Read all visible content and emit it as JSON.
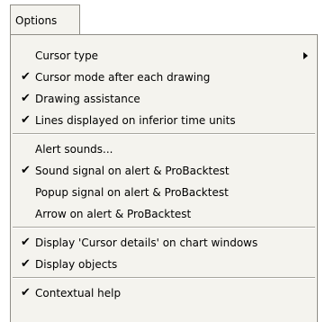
{
  "menubar": {
    "options_label": "Options"
  },
  "menu": {
    "items": [
      {
        "label": "Cursor type",
        "checked": false,
        "submenu": true
      },
      {
        "label": "Cursor mode after each drawing",
        "checked": true
      },
      {
        "label": "Drawing assistance",
        "checked": true
      },
      {
        "label": "Lines displayed on inferior time units",
        "checked": true
      },
      {
        "label": "Alert sounds...",
        "checked": false
      },
      {
        "label": "Sound signal on alert & ProBacktest",
        "checked": true
      },
      {
        "label": "Popup signal on alert & ProBacktest",
        "checked": false
      },
      {
        "label": "Arrow on alert & ProBacktest",
        "checked": false
      },
      {
        "label": "Display 'Cursor details' on chart windows",
        "checked": true
      },
      {
        "label": "Display objects",
        "checked": true
      },
      {
        "label": "Contextual help",
        "checked": true
      }
    ]
  },
  "icons": {
    "check": "✔",
    "submenu_arrow": "triangle-right-icon"
  }
}
